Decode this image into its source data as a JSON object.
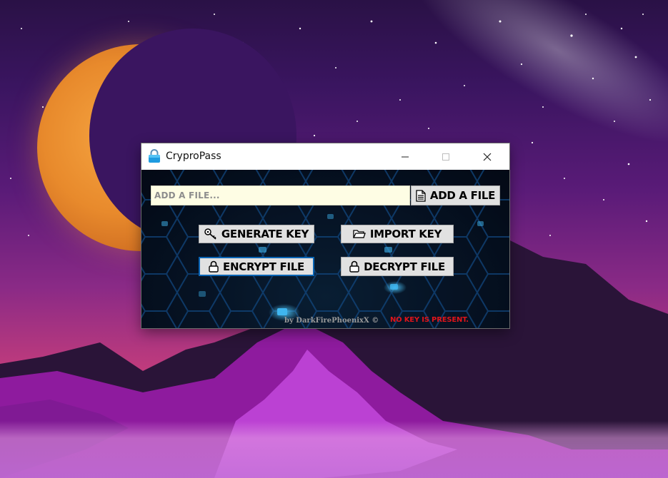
{
  "window": {
    "title": "CryproPass"
  },
  "file_section": {
    "input_placeholder": "ADD A FILE...",
    "add_file_label": "ADD A FILE"
  },
  "actions": {
    "generate_key_label": "GENERATE KEY",
    "import_key_label": "IMPORT KEY",
    "encrypt_file_label": "ENCRYPT FILE",
    "decrypt_file_label": "DECRYPT FILE"
  },
  "footer": {
    "credit": "by DarkFirePhoenixX ©",
    "status": "NO KEY IS PRESENT."
  },
  "icons": {
    "app": "lock-icon",
    "add_file": "document-icon",
    "generate_key": "key-icon",
    "import_key": "folder-icon",
    "encrypt": "lock-icon",
    "decrypt": "lock-icon"
  },
  "colors": {
    "status_text": "#e0141a",
    "input_background": "#fefde4",
    "button_background": "#e1e1e1",
    "focus_border": "#0a64b4"
  }
}
